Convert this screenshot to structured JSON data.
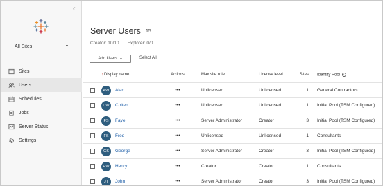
{
  "sidebar": {
    "site": "All Sites",
    "items": [
      {
        "label": "Sites",
        "icon": "sites-icon"
      },
      {
        "label": "Users",
        "icon": "users-icon"
      },
      {
        "label": "Schedules",
        "icon": "calendar-icon"
      },
      {
        "label": "Jobs",
        "icon": "jobs-icon"
      },
      {
        "label": "Server Status",
        "icon": "status-icon"
      },
      {
        "label": "Settings",
        "icon": "gear-icon"
      }
    ]
  },
  "main": {
    "title": "Server Users",
    "count": "15",
    "creator": "Creator: 10/10",
    "explorer": "Explorer: 0/0",
    "add_users": "Add Users",
    "select_all": "Select All"
  },
  "table": {
    "headers": {
      "name": "Display name",
      "actions": "Actions",
      "role": "Max site role",
      "license": "License level",
      "sites": "Sites",
      "pool": "Identity Pool"
    },
    "rows": [
      {
        "initials": "AW",
        "name": "Alan",
        "role": "Unlicensed",
        "license": "Unlicensed",
        "sites": "1",
        "pool": "General Contractors"
      },
      {
        "initials": "CW",
        "name": "Colten",
        "role": "Unlicensed",
        "license": "Unlicensed",
        "sites": "1",
        "pool": "Initial Pool (TSM Configured)"
      },
      {
        "initials": "FS",
        "name": "Faye",
        "role": "Server Administrator",
        "license": "Creator",
        "sites": "3",
        "pool": "Initial Pool (TSM Configured)"
      },
      {
        "initials": "FS",
        "name": "Fred",
        "role": "Unlicensed",
        "license": "Unlicensed",
        "sites": "1",
        "pool": "Consultants"
      },
      {
        "initials": "GS",
        "name": "George",
        "role": "Server Administrator",
        "license": "Creator",
        "sites": "3",
        "pool": "Initial Pool (TSM Configured)"
      },
      {
        "initials": "HW",
        "name": "Henry",
        "role": "Creator",
        "license": "Creator",
        "sites": "1",
        "pool": "Consultants"
      },
      {
        "initials": "JT",
        "name": "John",
        "role": "Server Administrator",
        "license": "Creator",
        "sites": "3",
        "pool": "Initial Pool (TSM Configured)"
      }
    ]
  },
  "colors": {
    "avatar": "#2e5d7e",
    "link": "#1f5fa8",
    "sort": "#c0392b"
  }
}
